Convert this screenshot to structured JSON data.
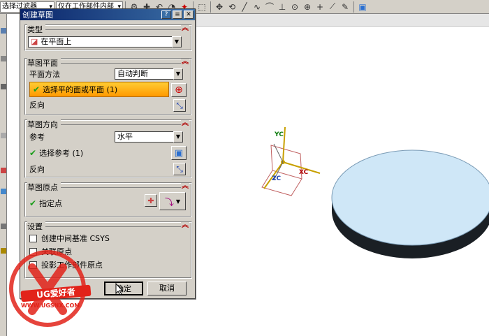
{
  "toolbar": {
    "filter_select": "选择过滤器",
    "scope_select": "仅在工作部件内部"
  },
  "dialog": {
    "title": "创建草图",
    "type_group": {
      "title": "类型",
      "value": "在平面上"
    },
    "sketch_plane": {
      "title": "草图平面",
      "method_label": "平面方法",
      "method_value": "自动判断",
      "select_label": "选择平的面或平面 (1)",
      "reverse_label": "反向"
    },
    "sketch_orientation": {
      "title": "草图方向",
      "ref_label": "参考",
      "ref_value": "水平",
      "select_label": "选择参考 (1)",
      "reverse_label": "反向"
    },
    "sketch_origin": {
      "title": "草图原点",
      "point_label": "指定点"
    },
    "settings": {
      "title": "设置",
      "opt1": "创建中间基准 CSYS",
      "opt2": "关联原点",
      "opt3": "投影工作部件原点"
    },
    "ok": "确定",
    "cancel": "取消"
  },
  "axes": {
    "yc": "YC",
    "xc": "XC",
    "zc": "ZC"
  },
  "watermark": {
    "logo": "UG爱好者",
    "url": "WWW.UGSNX.COM"
  },
  "colors": {
    "highlight": "#ff9900",
    "disc_top": "#cfe7f7",
    "disc_side": "#1a1f24",
    "title_bar": "#0a246a"
  }
}
